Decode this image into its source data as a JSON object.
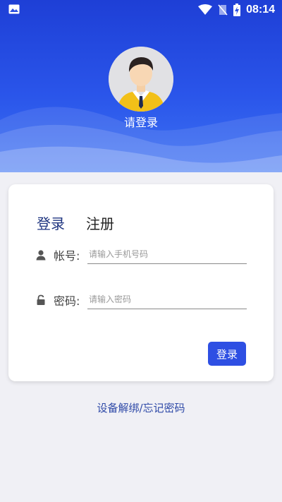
{
  "status": {
    "time": "08:14",
    "icons": [
      "image-icon",
      "wifi-icon",
      "no-sim-icon",
      "battery-charging-icon"
    ]
  },
  "header": {
    "avatar_caption": "请登录",
    "gradient_top": "#1e3fd6",
    "gradient_bottom": "#3d72f3"
  },
  "tabs": {
    "login": "登录",
    "register": "注册"
  },
  "form": {
    "account": {
      "label": "帐号:",
      "placeholder": "请输入手机号码",
      "value": ""
    },
    "password": {
      "label": "密码:",
      "placeholder": "请输入密码",
      "value": ""
    },
    "submit_label": "登录"
  },
  "footer": {
    "link": "设备解绑/忘记密码"
  },
  "colors": {
    "accent": "#2e4fe3",
    "page_bg": "#f0f0f5",
    "link": "#2f4aa8"
  }
}
